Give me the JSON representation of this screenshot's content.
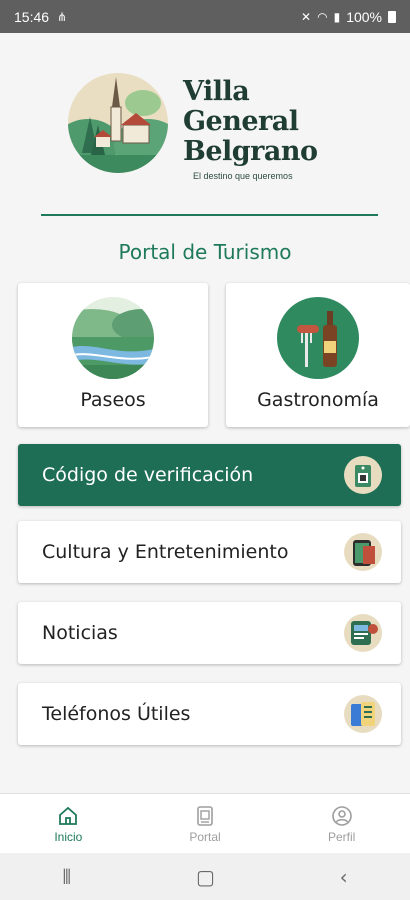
{
  "status_bar": {
    "time": "15:46",
    "battery": "100%"
  },
  "brand": {
    "line1": "Villa General",
    "line2": "Belgrano",
    "tagline": "El destino que queremos"
  },
  "portal_title": "Portal de Turismo",
  "tiles": [
    {
      "label": "Paseos",
      "icon": "landscape-icon"
    },
    {
      "label": "Gastronomía",
      "icon": "food-icon"
    }
  ],
  "rows": [
    {
      "label": "Código de verificación",
      "icon": "verification-tag-icon"
    },
    {
      "label": "Cultura y Entretenimiento",
      "icon": "culture-phone-icon"
    },
    {
      "label": "Noticias",
      "icon": "news-icon"
    },
    {
      "label": "Teléfonos Útiles",
      "icon": "phone-directory-icon"
    }
  ],
  "bottom_nav": [
    {
      "label": "Inicio",
      "icon": "home-icon",
      "active": true
    },
    {
      "label": "Portal",
      "icon": "portal-icon",
      "active": false
    },
    {
      "label": "Perfil",
      "icon": "profile-icon",
      "active": false
    }
  ],
  "colors": {
    "primary": "#1e7a5a",
    "primary_dark": "#1e6e55",
    "text": "#222222",
    "inactive": "#9e9e9e"
  }
}
